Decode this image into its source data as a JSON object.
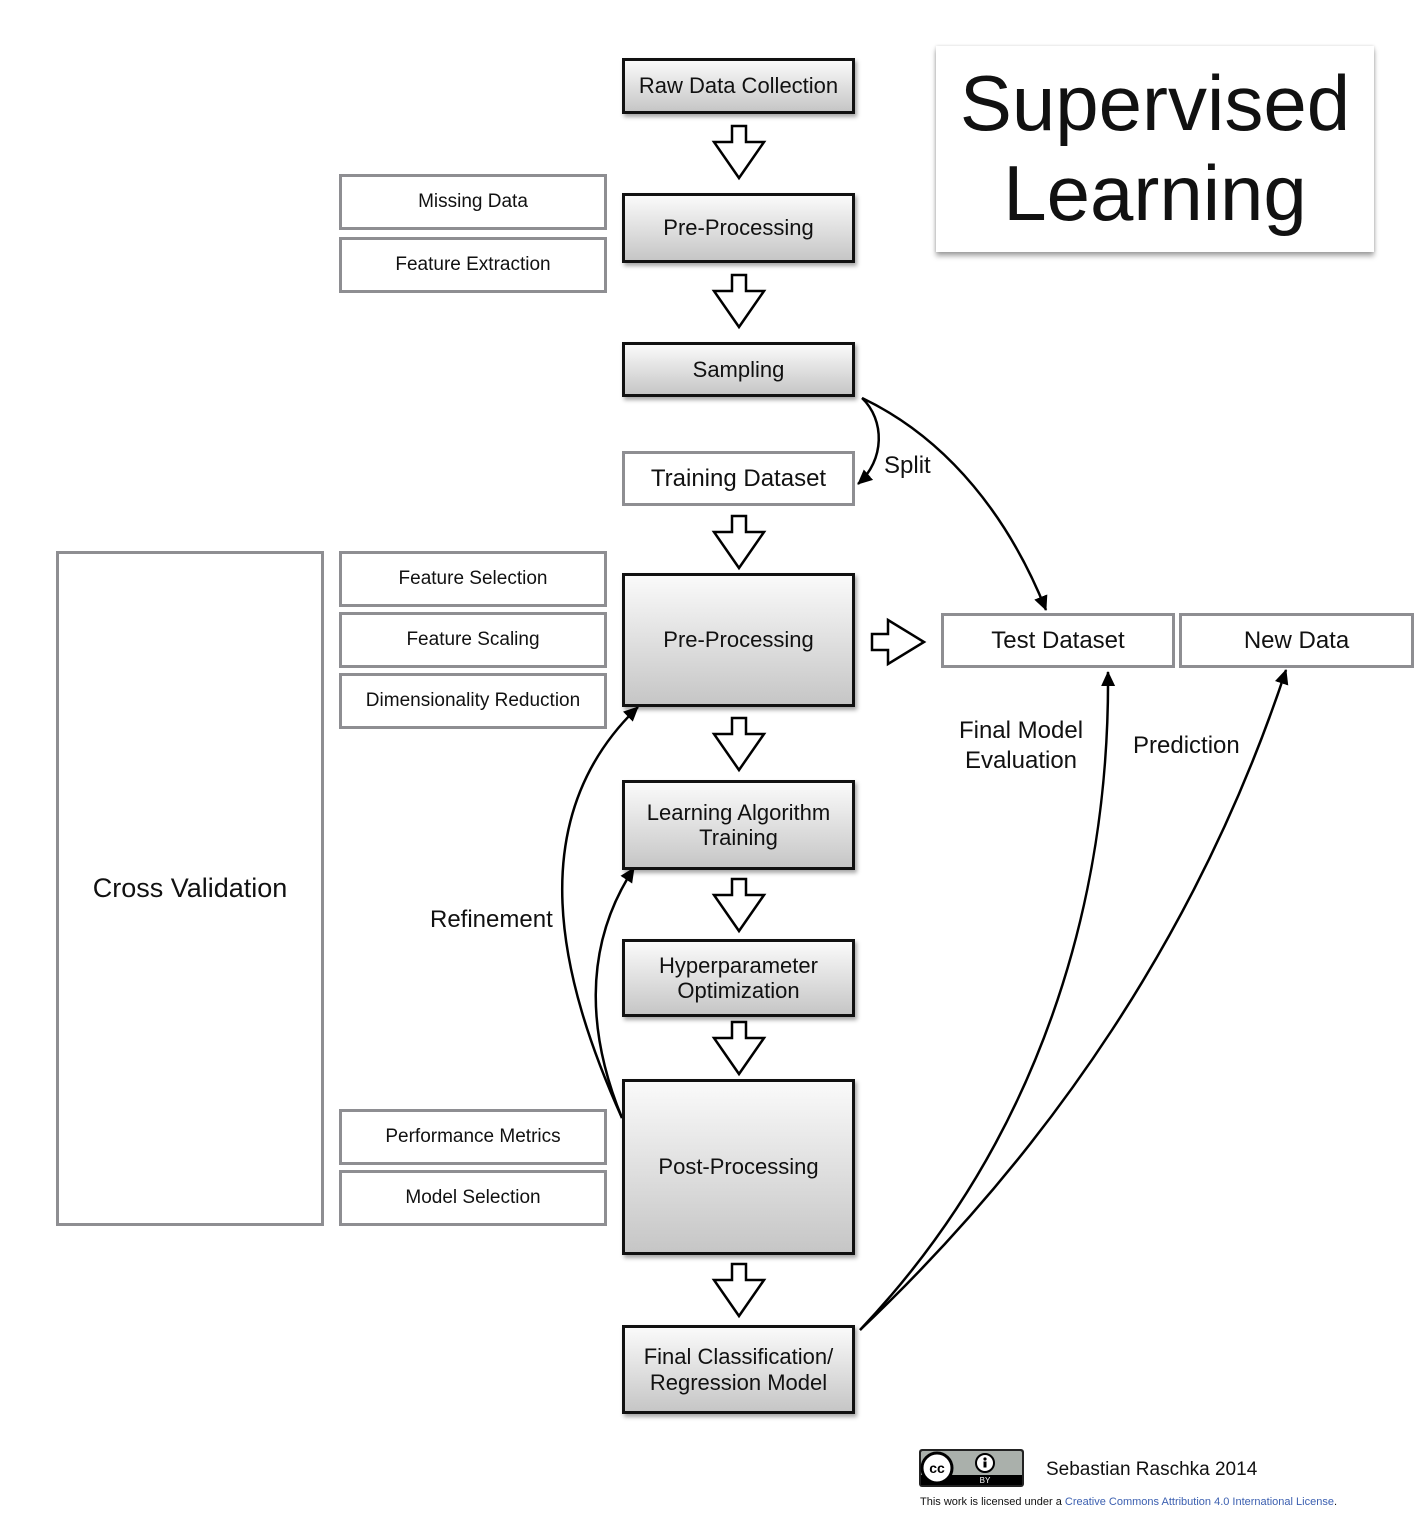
{
  "title": {
    "line1": "Supervised",
    "line2": "Learning"
  },
  "pipeline": {
    "raw_data_collection": "Raw Data Collection",
    "pre_processing_1": "Pre-Processing",
    "sampling": "Sampling",
    "training_dataset": "Training Dataset",
    "pre_processing_2": "Pre-Processing",
    "learning_algorithm_line1": "Learning Algorithm",
    "learning_algorithm_line2": "Training",
    "hyperparameter_line1": "Hyperparameter",
    "hyperparameter_line2": "Optimization",
    "post_processing": "Post-Processing",
    "final_model_line1": "Final Classification/",
    "final_model_line2": "Regression Model"
  },
  "side_boxes": {
    "missing_data": "Missing Data",
    "feature_extraction": "Feature Extraction",
    "feature_selection": "Feature Selection",
    "feature_scaling": "Feature Scaling",
    "dimensionality_reduction": "Dimensionality Reduction",
    "performance_metrics": "Performance Metrics",
    "model_selection": "Model Selection"
  },
  "cross_validation": "Cross Validation",
  "test_dataset": "Test Dataset",
  "new_data": "New Data",
  "edge_labels": {
    "split": "Split",
    "refinement": "Refinement",
    "final_model_evaluation_line1": "Final Model",
    "final_model_evaluation_line2": "Evaluation",
    "prediction": "Prediction"
  },
  "footer": {
    "cc_label": "cc",
    "by_label": "BY",
    "author": "Sebastian Raschka 2014",
    "license_prefix": "This work is licensed under a ",
    "license_link": "Creative Commons Attribution 4.0 International License",
    "license_suffix": "."
  },
  "colors": {
    "link": "#3b5fb0",
    "side_border": "#8e8e92",
    "step_border": "#111111"
  }
}
